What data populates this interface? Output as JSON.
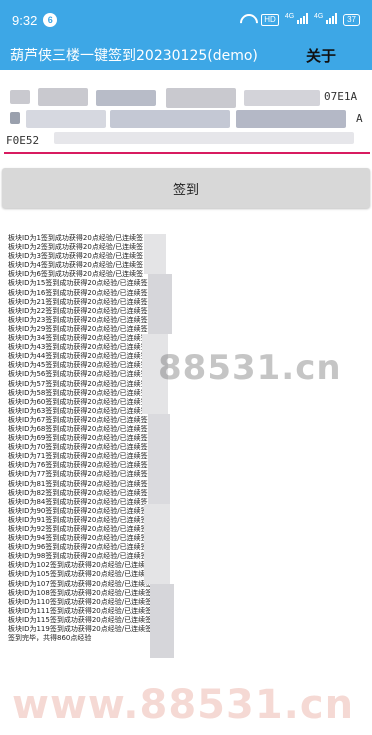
{
  "status_bar": {
    "time": "9:32",
    "notification_count": "6",
    "hd_label": "HD",
    "signal_label_1": "4G",
    "signal_label_2": "4G",
    "battery": "37"
  },
  "app_bar": {
    "title": "葫芦侠三楼一键签到20230125(demo)",
    "about_label": "关于"
  },
  "input": {
    "visible_fragment_1": "07E1A",
    "visible_fragment_2": "A",
    "visible_fragment_3": "F0E52"
  },
  "sign_button_label": "签到",
  "log_lines": [
    "板块ID为1签到成功获得20点经验/已连续签",
    "板块ID为2签到成功获得20点经验/已连续签",
    "板块ID为3签到成功获得20点经验/已连续签",
    "板块ID为4签到成功获得20点经验/已连续签",
    "板块ID为6签到成功获得20点经验/已连续签",
    "板块ID为15签到成功获得20点经验/已连续签",
    "板块ID为16签到成功获得20点经验/已连续签",
    "板块ID为21签到成功获得20点经验/已连续签",
    "板块ID为22签到成功获得20点经验/已连续签",
    "板块ID为23签到成功获得20点经验/已连续签",
    "板块ID为29签到成功获得20点经验/已连续签",
    "板块ID为34签到成功获得20点经验/已连续签",
    "板块ID为43签到成功获得20点经验/已连续签",
    "板块ID为44签到成功获得20点经验/已连续签",
    "板块ID为45签到成功获得20点经验/已连续签",
    "板块ID为56签到成功获得20点经验/已连续签",
    "板块ID为57签到成功获得20点经验/已连续签",
    "板块ID为58签到成功获得20点经验/已连续签",
    "板块ID为60签到成功获得20点经验/已连续签",
    "板块ID为63签到成功获得20点经验/已连续签",
    "板块ID为67签到成功获得20点经验/已连续签",
    "板块ID为68签到成功获得20点经验/已连续签",
    "板块ID为69签到成功获得20点经验/已连续签",
    "板块ID为70签到成功获得20点经验/已连续签",
    "板块ID为71签到成功获得20点经验/已连续签",
    "板块ID为76签到成功获得20点经验/已连续签",
    "板块ID为77签到成功获得20点经验/已连续签",
    "板块ID为81签到成功获得20点经验/已连续签",
    "板块ID为82签到成功获得20点经验/已连续签",
    "板块ID为84签到成功获得20点经验/已连续签",
    "板块ID为90签到成功获得20点经验/已连续签",
    "板块ID为91签到成功获得20点经验/已连续签",
    "板块ID为92签到成功获得20点经验/已连续签",
    "板块ID为94签到成功获得20点经验/已连续签",
    "板块ID为96签到成功获得20点经验/已连续签",
    "板块ID为98签到成功获得20点经验/已连续签",
    "板块ID为102签到成功获得20点经验/已连续签",
    "板块ID为105签到成功获得20点经验/已连续签",
    "板块ID为107签到成功获得20点经验/已连续签",
    "板块ID为108签到成功获得20点经验/已连续签",
    "板块ID为110签到成功获得20点经验/已连续签",
    "板块ID为111签到成功获得20点经验/已连续签",
    "板块ID为115签到成功获得20点经验/已连续签",
    "板块ID为119签到成功获得20点经验/已连续签",
    "签到完毕，共得860点经验"
  ],
  "watermarks": {
    "middle": "88531.cn",
    "bottom": "www.88531.cn"
  }
}
